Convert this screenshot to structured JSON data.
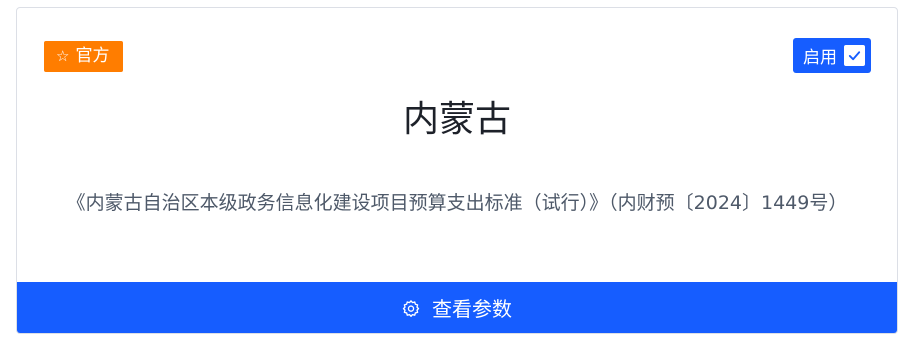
{
  "card": {
    "badge": {
      "icon": "star-outline-icon",
      "label": "官方",
      "color": "#ff7d00"
    },
    "toggle": {
      "label": "启用",
      "checked": true,
      "color": "#165dff"
    },
    "title": "内蒙古",
    "description": "《内蒙古自治区本级政务信息化建设项目预算支出标准（试行）》（内财预〔2024〕1449号）",
    "action": {
      "icon": "settings-icon",
      "label": "查看参数"
    }
  }
}
